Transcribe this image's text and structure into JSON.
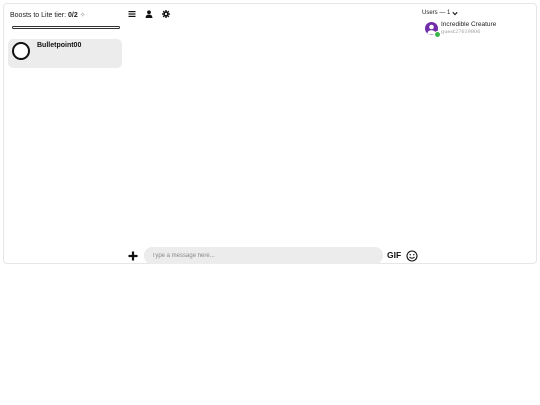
{
  "sidebar": {
    "boosts_label": "Boosts to Lite tier: ",
    "boosts_count": "0/2",
    "boosts_icon": "sparkle-icon",
    "boost_progress": 0,
    "servers": [
      {
        "name": "Bulletpoint00",
        "icon": "ring-avatar"
      }
    ]
  },
  "toolbar": {
    "icons": [
      "menu-icon",
      "user-icon",
      "gear-icon"
    ]
  },
  "users": {
    "header": "Users — 1",
    "list": [
      {
        "name": "Incredible Creature",
        "sub": "guest27619806",
        "status_color": "#3bb54a",
        "avatar_color": "#6f2da8"
      }
    ]
  },
  "composer": {
    "placeholder": "Type a message here...",
    "value": "",
    "gif_label": "GIF"
  }
}
